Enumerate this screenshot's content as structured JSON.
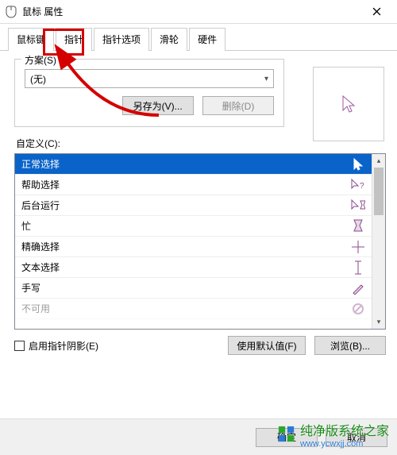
{
  "window": {
    "title": "鼠标 属性"
  },
  "tabs": {
    "items": [
      {
        "label": "鼠标键"
      },
      {
        "label": "指针"
      },
      {
        "label": "指针选项"
      },
      {
        "label": "滑轮"
      },
      {
        "label": "硬件"
      }
    ],
    "active_index": 1
  },
  "scheme": {
    "group_label": "方案(S)",
    "selected": "(无)",
    "save_as": "另存为(V)...",
    "delete": "删除(D)"
  },
  "customize": {
    "label": "自定义(C):",
    "items": [
      {
        "label": "正常选择",
        "icon": "cursor-arrow-icon"
      },
      {
        "label": "帮助选择",
        "icon": "cursor-help-icon"
      },
      {
        "label": "后台运行",
        "icon": "cursor-working-icon"
      },
      {
        "label": "忙",
        "icon": "cursor-busy-icon"
      },
      {
        "label": "精确选择",
        "icon": "cursor-crosshair-icon"
      },
      {
        "label": "文本选择",
        "icon": "cursor-text-icon"
      },
      {
        "label": "手写",
        "icon": "cursor-pen-icon"
      },
      {
        "label": "不可用",
        "icon": "cursor-no-icon"
      }
    ],
    "selected_index": 0
  },
  "options": {
    "shadow_checkbox": "启用指针阴影(E)",
    "use_default": "使用默认值(F)",
    "browse": "浏览(B)..."
  },
  "footer": {
    "ok": "确定",
    "cancel": "取消"
  },
  "watermark": {
    "text": "纯净版系统之家",
    "url": "www.ycwxjj.com"
  }
}
